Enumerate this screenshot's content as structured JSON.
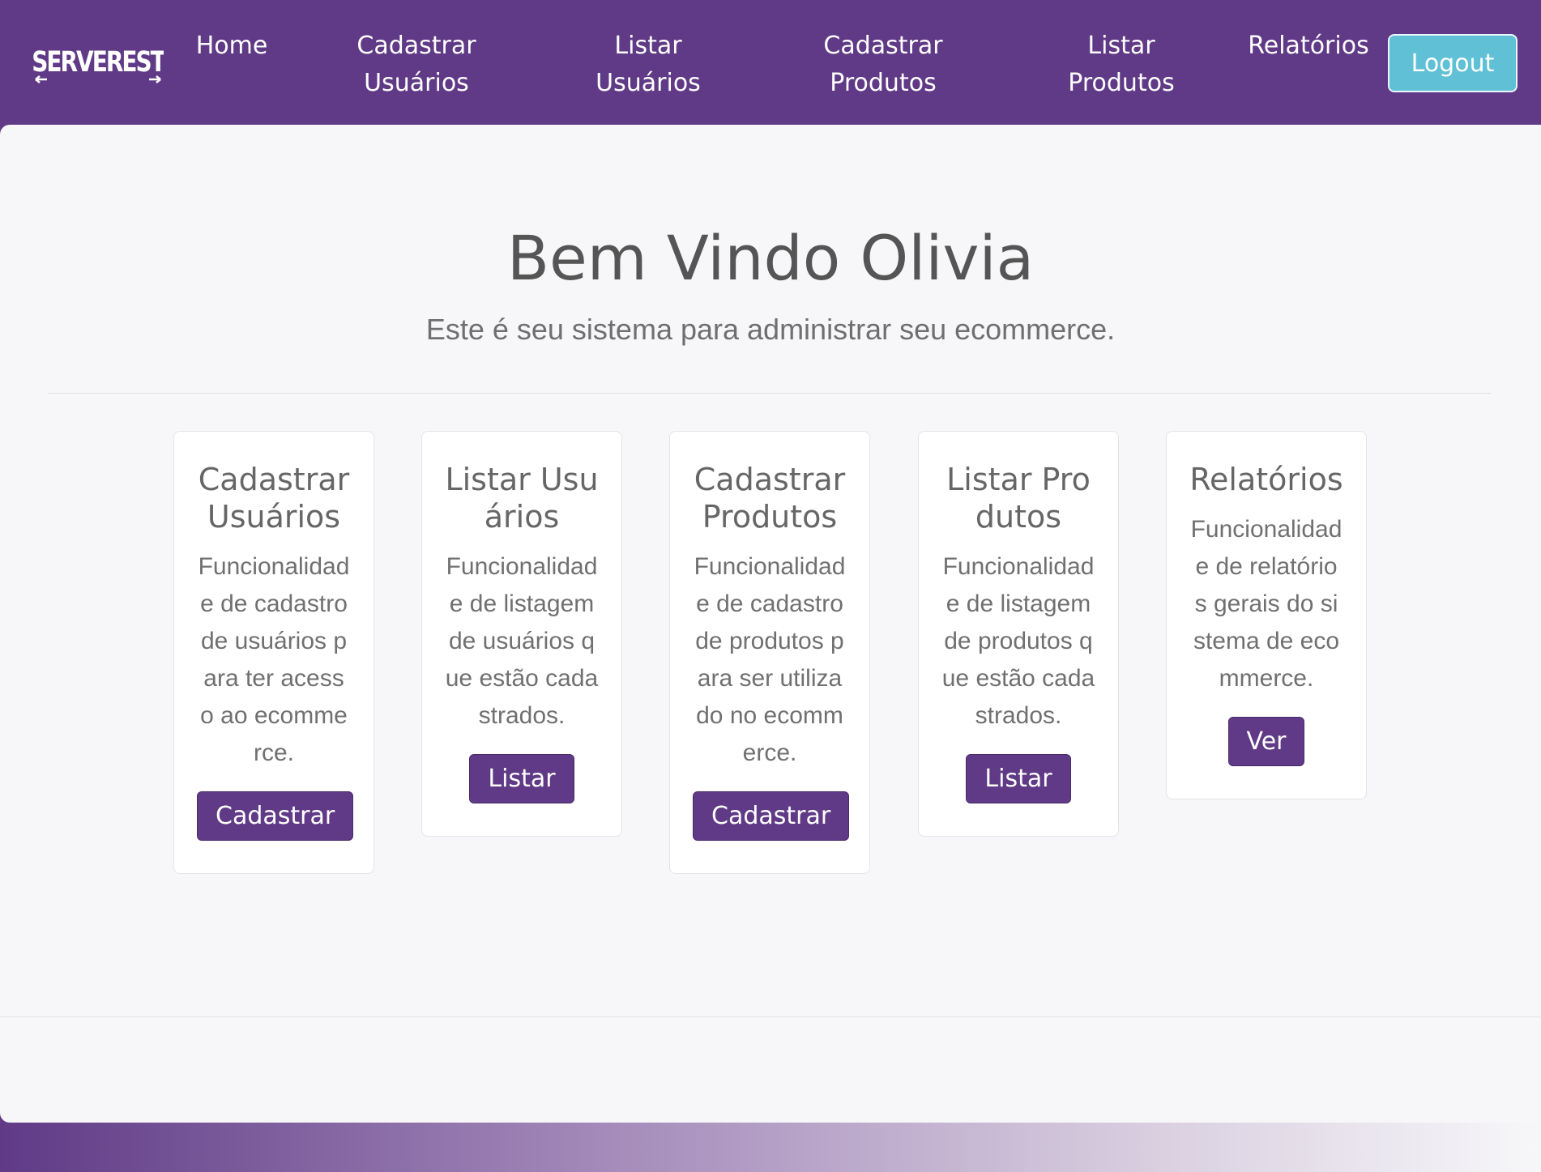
{
  "brand": {
    "logo_text": "SERVEREST"
  },
  "nav": {
    "home": "Home",
    "cadastrar_usuarios": [
      "Cadastrar",
      "Usuários"
    ],
    "listar_usuarios": [
      "Listar",
      "Usuários"
    ],
    "cadastrar_produtos": [
      "Cadastrar",
      "Produtos"
    ],
    "listar_produtos": [
      "Listar",
      "Produtos"
    ],
    "relatorios": "Relatórios",
    "logout": "Logout"
  },
  "welcome": {
    "title": "Bem Vindo Olivia",
    "subtitle": "Este é seu sistema para administrar seu ecommerce."
  },
  "cards": [
    {
      "title": "Cadastrar Usuários",
      "text": "Funcionalidade de cadastro de usuários para ter acesso ao ecommerce.",
      "button": "Cadastrar"
    },
    {
      "title": "Listar Usuários",
      "text": "Funcionalidade de listagem de usuários que estão cadastrados.",
      "button": "Listar"
    },
    {
      "title": "Cadastrar Produtos",
      "text": "Funcionalidade de cadastro de produtos para ser utilizado no ecommerce.",
      "button": "Cadastrar"
    },
    {
      "title": "Listar Produtos",
      "text": "Funcionalidade de listagem de produtos que estão cadastrados.",
      "button": "Listar"
    },
    {
      "title": "Relatórios",
      "text": "Funcionalidade de relatórios gerais do sistema de ecommerce.",
      "button": "Ver"
    }
  ],
  "colors": {
    "primary": "#603a86",
    "logout": "#5fc0d6",
    "background": "#f7f7f9"
  }
}
